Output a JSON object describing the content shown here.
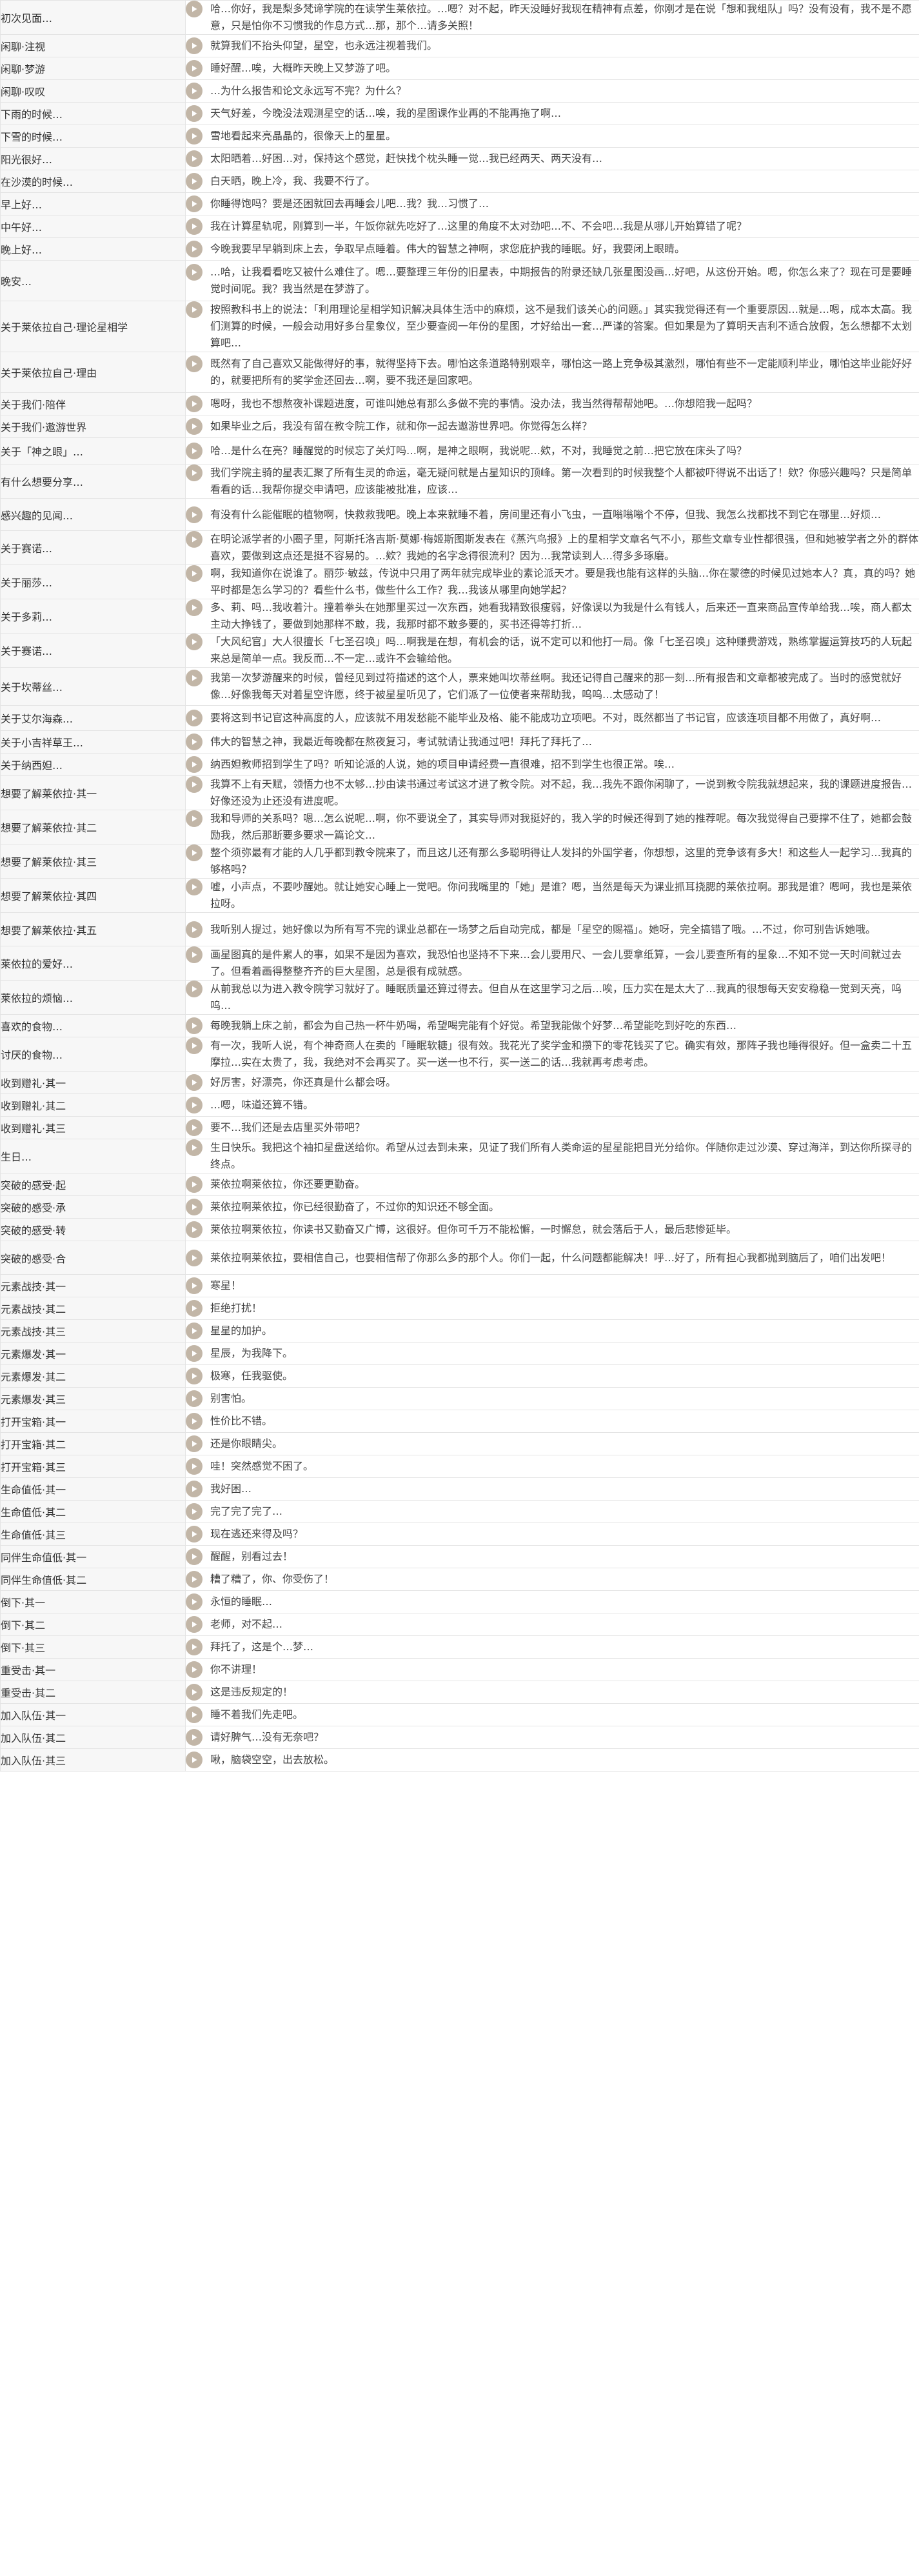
{
  "voice_lines": [
    {
      "title": "初次见面…",
      "text": "哈…你好，我是梨多梵谛学院的在读学生莱依拉。…嗯？对不起，昨天没睡好我现在精神有点差，你刚才是在说「想和我组队」吗？没有没有，我不是不愿意，只是怕你不习惯我的作息方式…那，那个…请多关照！"
    },
    {
      "title": "闲聊·注视",
      "text": "就算我们不抬头仰望，星空，也永远注视着我们。"
    },
    {
      "title": "闲聊·梦游",
      "text": "睡好醒…唉，大概昨天晚上又梦游了吧。"
    },
    {
      "title": "闲聊·叹叹",
      "text": "…为什么报告和论文永远写不完？为什么？"
    },
    {
      "title": "下雨的时候…",
      "text": "天气好差，今晚没法观测星空的话…唉，我的星图课作业再的不能再拖了啊…"
    },
    {
      "title": "下雪的时候…",
      "text": "雪地看起来亮晶晶的，很像天上的星星。"
    },
    {
      "title": "阳光很好…",
      "text": "太阳晒着…好困…对，保持这个感觉，赶快找个枕头睡一觉…我已经两天、两天没有…"
    },
    {
      "title": "在沙漠的时候…",
      "text": "白天晒，晚上冷，我、我要不行了。"
    },
    {
      "title": "早上好…",
      "text": "你睡得饱吗？要是还困就回去再睡会儿吧…我？我…习惯了…"
    },
    {
      "title": "中午好…",
      "text": "我在计算星轨呢，刚算到一半，午饭你就先吃好了…这里的角度不太对劲吧…不、不会吧…我是从哪儿开始算错了呢？"
    },
    {
      "title": "晚上好…",
      "text": "今晚我要早早躺到床上去，争取早点睡着。伟大的智慧之神啊，求您庇护我的睡眠。好，我要闭上眼睛。"
    },
    {
      "title": "晚安…",
      "text": "…哈，让我看看吃又被什么难住了。嗯…要整理三年份的旧星表，中期报告的附录还缺几张星图没画…好吧，从这份开始。嗯，你怎么来了？现在可是要睡觉时间呢。我？我当然是在梦游了。"
    },
    {
      "title": "关于莱依拉自己·理论星相学",
      "text": "按照教科书上的说法：「利用理论星相学知识解决具体生活中的麻烦，这不是我们该关心的问题。」其实我觉得还有一个重要原因…就是…嗯，成本太高。我们测算的时候，一般会动用好多台星象仪，至少要查阅一年份的星图，才好给出一套…严谨的答案。但如果是为了算明天吉利不适合放假，怎么想都不太划算吧…"
    },
    {
      "title": "关于莱依拉自己·理由",
      "text": "既然有了自己喜欢又能做得好的事，就得坚持下去。哪怕这条道路特别艰辛，哪怕这一路上竞争极其激烈，哪怕有些不一定能顺利毕业，哪怕这毕业能好好的，就要把所有的奖学金还回去…啊，要不我还是回家吧。"
    },
    {
      "title": "关于我们·陪伴",
      "text": "嗯呀，我也不想熬夜补课题进度，可谁叫她总有那么多做不完的事情。没办法，我当然得帮帮她吧。…你想陪我一起吗？"
    },
    {
      "title": "关于我们·遨游世界",
      "text": "如果毕业之后，我没有留在教令院工作，就和你一起去遨游世界吧。你觉得怎么样？"
    },
    {
      "title": "关于「神之眼」…",
      "text": "哈…是什么在亮？睡醒觉的时候忘了关灯吗…啊，是神之眼啊，我说呢…欸，不对，我睡觉之前…把它放在床头了吗？"
    },
    {
      "title": "有什么想要分享…",
      "text": "我们学院主骑的星表汇聚了所有生灵的命运，毫无疑问就是占星知识的顶峰。第一次看到的时候我整个人都被吓得说不出话了！欸？你感兴趣吗？只是简单看看的话…我帮你提交申请吧，应该能被批准，应该…"
    },
    {
      "title": "感兴趣的见闻…",
      "text": "有没有什么能催眠的植物啊，快救救我吧。晚上本来就睡不着，房间里还有小飞虫，一直嗡嗡嗡个不停，但我、我怎么找都找不到它在哪里…好烦…"
    },
    {
      "title": "关于赛诺…",
      "text": "在明论派学者的小圈子里，阿斯托洛吉斯·莫娜·梅姬斯图斯发表在《蒸汽鸟报》上的星相学文章名气不小，那些文章专业性都很强，但和她被学者之外的群体喜欢，要做到这点还是挺不容易的。…欸？我她的名字念得很流利？因为…我常读到人…得多多琢磨。"
    },
    {
      "title": "关于丽莎…",
      "text": "啊，我知道你在说谁了。丽莎·敏兹，传说中只用了两年就完成毕业的素论派天才。要是我也能有这样的头脑…你在蒙德的时候见过她本人？真，真的吗？她平时都是怎么学习的？看些什么书，做些什么工作？我…我该从哪里向她学起？"
    },
    {
      "title": "关于多莉…",
      "text": "多、莉、吗…我收着汁。撞着拳头在她那里买过一次东西，她看我精致很瘦弱，好像误以为我是什么有钱人，后来还一直来商品宣传单给我…唉，商人都太主动大挣钱了，要做到她那样不敢，我，我那时都不敢多要的，买书还得等打折…"
    },
    {
      "title": "关于赛诺…",
      "text": "「大风纪官」大人很擅长「七圣召唤」吗…啊我是在想，有机会的话，说不定可以和他打一局。像「七圣召唤」这种赚费游戏，熟练掌握运算技巧的人玩起来总是简单一点。我反而…不一定…或许不会输给他。"
    },
    {
      "title": "关于坎蒂丝…",
      "text": "我第一次梦游醒来的时候，曾经见到过符描述的这个人，票来她叫坎蒂丝啊。我还记得自己醒来的那一刻…所有报告和文章都被完成了。当时的感觉就好像…好像我每天对着星空许愿，终于被星星听见了，它们派了一位使者来帮助我，呜呜…太感动了！"
    },
    {
      "title": "关于艾尔海森…",
      "text": "要将这到书记官这种高度的人，应该就不用发愁能不能毕业及格、能不能成功立项吧。不对，既然都当了书记官，应该连项目都不用做了，真好啊…"
    },
    {
      "title": "关于小吉祥草王…",
      "text": "伟大的智慧之神，我最近每晚都在熬夜复习，考试就请让我通过吧！拜托了拜托了…"
    },
    {
      "title": "关于纳西妲…",
      "text": "纳西妲教师招到学生了吗？听知论派的人说，她的项目申请经费一直很难，招不到学生也很正常。唉…"
    },
    {
      "title": "想要了解莱依拉·其一",
      "text": "我算不上有天赋，领悟力也不太够…抄由读书通过考试这才进了教令院。对不起，我…我先不跟你闲聊了，一说到教令院我就想起来，我的课题进度报告…好像还没为止还没有进度呢。"
    },
    {
      "title": "想要了解莱依拉·其二",
      "text": "我和导师的关系吗？嗯…怎么说呢…啊，你不要说全了，其实导师对我挺好的，我入学的时候还得到了她的推荐呢。每次我觉得自己要撑不住了，她都会鼓励我，然后那断要多要求一篇论文…"
    },
    {
      "title": "想要了解莱依拉·其三",
      "text": "整个须弥最有才能的人几乎都到教令院来了，而且这儿还有那么多聪明得让人发抖的外国学者，你想想，这里的竞争该有多大！和这些人一起学习…我真的够格吗？"
    },
    {
      "title": "想要了解莱依拉·其四",
      "text": "嘘，小声点，不要吵醒她。就让她安心睡上一觉吧。你问我嘴里的「她」是谁？嗯，当然是每天为课业抓耳挠腮的莱依拉啊。那我是谁？嗯呵，我也是莱依拉呀。"
    },
    {
      "title": "想要了解莱依拉·其五",
      "text": "我听别人提过，她好像以为所有写不完的课业总都在一场梦之后自动完成，都是「星空的赐福」。她呀，完全搞错了哦。…不过，你可别告诉她哦。"
    },
    {
      "title": "莱依拉的爱好…",
      "text": "画星图真的是件累人的事，如果不是因为喜欢，我恐怕也坚持不下来…会儿要用尺、一会儿要拿纸算，一会儿要查所有的星象…不知不觉一天时间就过去了。但看着画得整整齐齐的巨大星图，总是很有成就感。"
    },
    {
      "title": "莱依拉的烦恼…",
      "text": "从前我总以为进入教令院学习就好了。睡眠质量还算过得去。但自从在这里学习之后…唉，压力实在是太大了…我真的很想每天安安稳稳一觉到天亮，呜呜…"
    },
    {
      "title": "喜欢的食物…",
      "text": "每晚我躺上床之前，都会为自己热一杯牛奶喝，希望喝完能有个好觉。希望我能做个好梦…希望能吃到好吃的东西…"
    },
    {
      "title": "讨厌的食物…",
      "text": "有一次，我听人说，有个神奇商人在卖的「睡眠软糖」很有效。我花光了奖学金和攒下的零花钱买了它。确实有效，那阵子我也睡得很好。但一盒卖二十五摩拉…实在太贵了，我，我绝对不会再买了。买一送一也不行，买一送二的话…我就再考虑考虑。"
    },
    {
      "title": "收到赠礼·其一",
      "text": "好厉害，好漂亮，你还真是什么都会呀。"
    },
    {
      "title": "收到赠礼·其二",
      "text": "…嗯，味道还算不错。"
    },
    {
      "title": "收到赠礼·其三",
      "text": "要不…我们还是去店里买外带吧？"
    },
    {
      "title": "生日…",
      "text": "生日快乐。我把这个袖扣星盘送给你。希望从过去到未来，见证了我们所有人类命运的星星能把目光分给你。伴随你走过沙漠、穿过海洋，到达你所探寻的终点。"
    },
    {
      "title": "突破的感受·起",
      "text": "莱依拉啊莱依拉，你还要更勤奋。"
    },
    {
      "title": "突破的感受·承",
      "text": "莱依拉啊莱依拉，你已经很勤奋了，不过你的知识还不够全面。"
    },
    {
      "title": "突破的感受·转",
      "text": "莱依拉啊莱依拉，你读书又勤奋又广博，这很好。但你可千万不能松懈，一时懈怠，就会落后于人，最后悲惨延毕。"
    },
    {
      "title": "突破的感受·合",
      "text": "莱依拉啊莱依拉，要相信自己，也要相信帮了你那么多的那个人。你们一起，什么问题都能解决！呼…好了，所有担心我都抛到脑后了，咱们出发吧！"
    },
    {
      "title": "元素战技·其一",
      "text": "寒星！"
    },
    {
      "title": "元素战技·其二",
      "text": "拒绝打扰！"
    },
    {
      "title": "元素战技·其三",
      "text": "星星的加护。"
    },
    {
      "title": "元素爆发·其一",
      "text": "星辰，为我降下。"
    },
    {
      "title": "元素爆发·其二",
      "text": "极寒，任我驱使。"
    },
    {
      "title": "元素爆发·其三",
      "text": "别害怕。"
    },
    {
      "title": "打开宝箱·其一",
      "text": "性价比不错。"
    },
    {
      "title": "打开宝箱·其二",
      "text": "还是你眼睛尖。"
    },
    {
      "title": "打开宝箱·其三",
      "text": "哇！突然感觉不困了。"
    },
    {
      "title": "生命值低·其一",
      "text": "我好困…"
    },
    {
      "title": "生命值低·其二",
      "text": "完了完了完了…"
    },
    {
      "title": "生命值低·其三",
      "text": "现在逃还来得及吗？"
    },
    {
      "title": "同伴生命值低·其一",
      "text": "醒醒，别看过去！"
    },
    {
      "title": "同伴生命值低·其二",
      "text": "糟了糟了，你、你受伤了！"
    },
    {
      "title": "倒下·其一",
      "text": "永恒的睡眠…"
    },
    {
      "title": "倒下·其二",
      "text": "老师，对不起…"
    },
    {
      "title": "倒下·其三",
      "text": "拜托了，这是个…梦…"
    },
    {
      "title": "重受击·其一",
      "text": "你不讲理！"
    },
    {
      "title": "重受击·其二",
      "text": "这是违反规定的！"
    },
    {
      "title": "加入队伍·其一",
      "text": "睡不着我们先走吧。"
    },
    {
      "title": "加入队伍·其二",
      "text": "请好脾气…没有无奈吧？"
    },
    {
      "title": "加入队伍·其三",
      "text": "啾，脑袋空空，出去放松。"
    }
  ],
  "icons": {
    "play": "play-audio-icon"
  },
  "colors": {
    "play_button": "#c2b6a7",
    "title_cell_bg": "#f7f7f7",
    "border": "#e4e4e4"
  }
}
